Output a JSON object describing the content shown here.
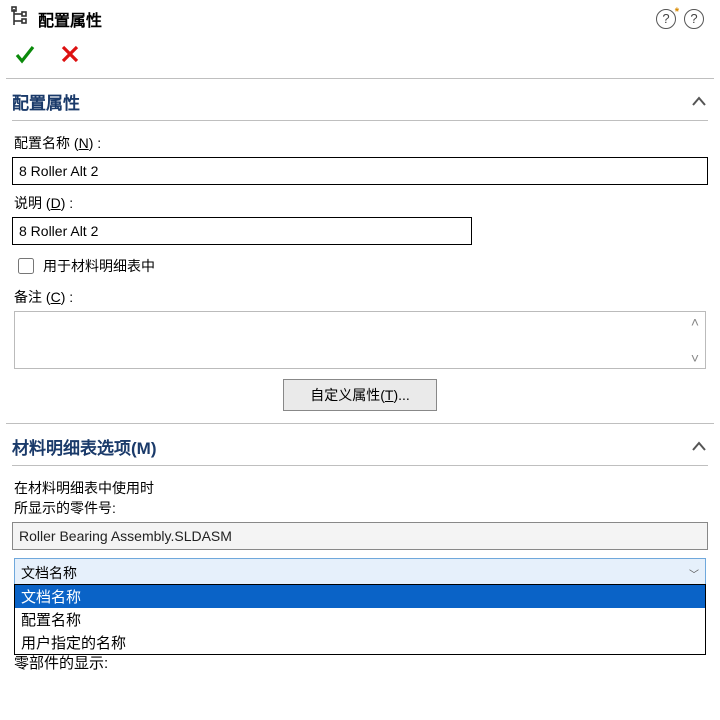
{
  "header": {
    "title": "配置属性"
  },
  "section_props": {
    "title": "配置属性",
    "name_label_prefix": "配置名称 (",
    "name_label_key": "N",
    "name_label_suffix": ") :",
    "name_value": "8 Roller Alt 2",
    "desc_label_prefix": "说明 (",
    "desc_label_key": "D",
    "desc_label_suffix": ") :",
    "desc_value": "8 Roller Alt 2",
    "use_in_bom_label": "用于材料明细表中",
    "notes_label_prefix": "备注 (",
    "notes_label_key": "C",
    "notes_label_suffix": ") :",
    "custom_props_btn_prefix": "自定义属性(",
    "custom_props_btn_key": "T",
    "custom_props_btn_suffix": ")..."
  },
  "section_bom": {
    "title": "材料明细表选项(M)",
    "usage_line1": "在材料明细表中使用时",
    "usage_line2": "所显示的零件号:",
    "part_value": "Roller Bearing Assembly.SLDASM",
    "dropdown": {
      "selected": "文档名称",
      "opt1": "文档名称",
      "opt2": "配置名称",
      "opt3": "用户指定的名称"
    },
    "below_text": "零部件的显示:"
  }
}
